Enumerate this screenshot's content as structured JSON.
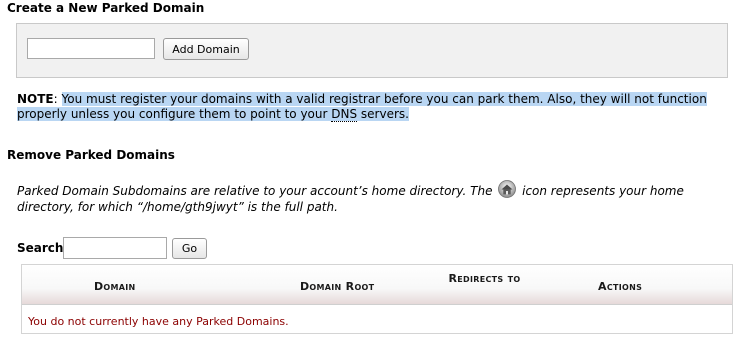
{
  "create": {
    "heading": "Create a New Parked Domain",
    "input_value": "",
    "add_button_label": "Add Domain"
  },
  "note": {
    "label": "NOTE",
    "text_part1": "You must register your domains with a valid registrar before you can park them. Also, they will not function properly unless you configure them to point to your ",
    "dns": "DNS",
    "text_part2": " servers."
  },
  "remove": {
    "heading": "Remove Parked Domains",
    "info_part1": "Parked Domain Subdomains are relative to your account’s home directory. The ",
    "home_icon": "home-icon",
    "info_part2": " icon represents your home directory, for which “/home/gth9jwyt” is the full path."
  },
  "search": {
    "label": "Search",
    "input_value": "",
    "go_label": "Go"
  },
  "table": {
    "columns": [
      "Domain",
      "Domain Root",
      "Redirects to",
      "Actions"
    ],
    "empty_message": "You do not currently have any Parked Domains."
  },
  "colors": {
    "highlight": "#b9d6f3",
    "empty_message": "#8b0000"
  }
}
